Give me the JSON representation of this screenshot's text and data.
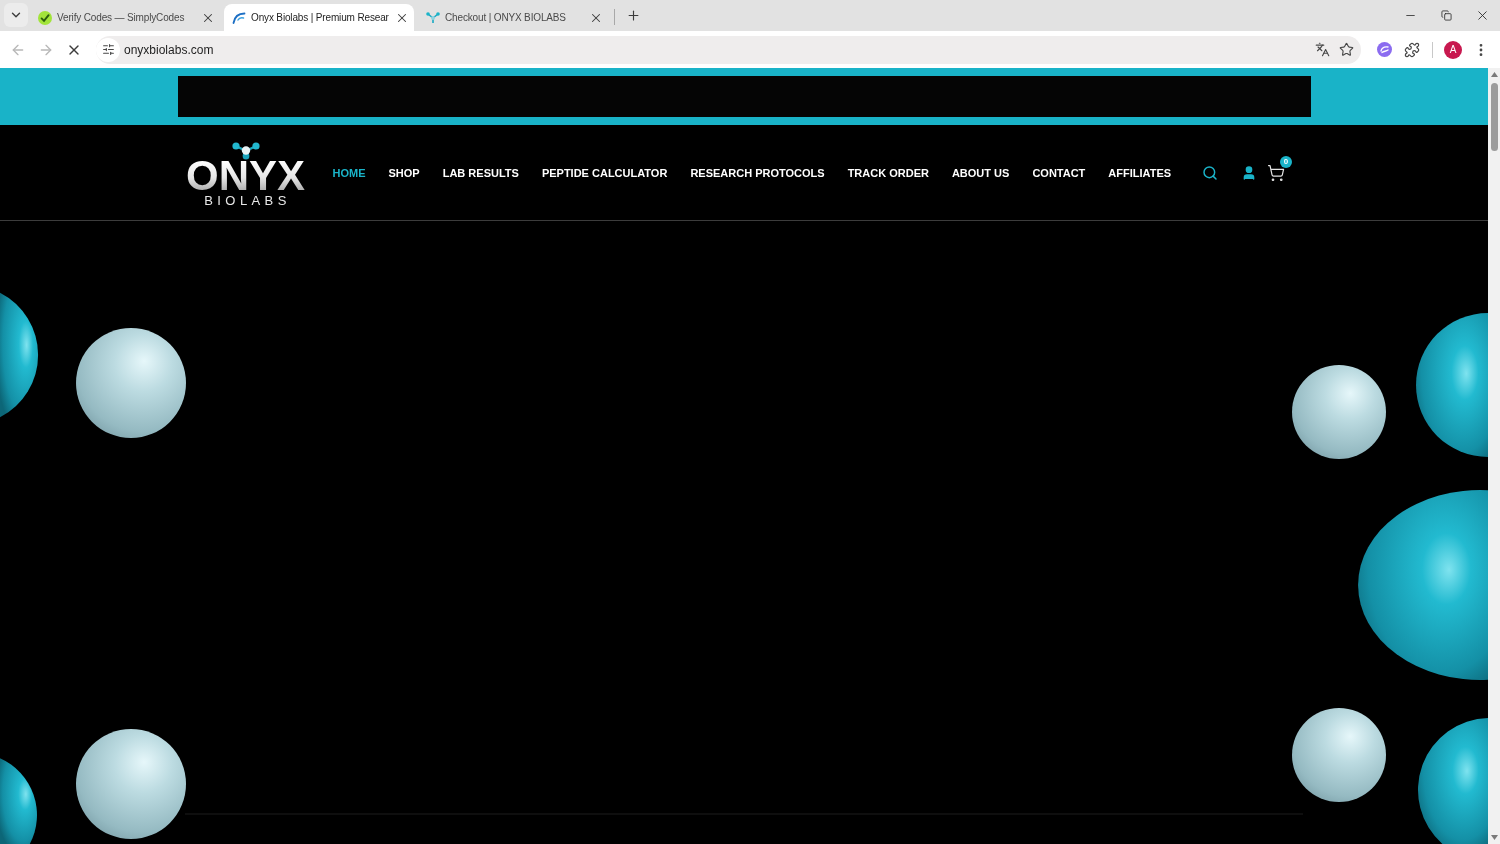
{
  "browser": {
    "tabs": [
      {
        "kind": "check",
        "title": "Verify Codes — SimplyCodes",
        "selected": false
      },
      {
        "kind": "swoosh",
        "title": "Onyx Biolabs | Premium Resear",
        "selected": true
      },
      {
        "kind": "molecule",
        "title": "Checkout | ONYX BIOLABS",
        "selected": false
      }
    ],
    "back": {
      "disabled": true
    },
    "forward": {
      "disabled": true
    },
    "loading": true,
    "address": "onyxbiolabs.com",
    "profile_initial": "A"
  },
  "page": {
    "logo": {
      "wordmark": "ONYX",
      "subtitle": "BIOLABS"
    },
    "nav": [
      {
        "label": "HOME",
        "selected": true
      },
      {
        "label": "SHOP",
        "selected": false
      },
      {
        "label": "LAB RESULTS",
        "selected": false
      },
      {
        "label": "PEPTIDE CALCULATOR",
        "selected": false
      },
      {
        "label": "RESEARCH PROTOCOLS",
        "selected": false
      },
      {
        "label": "TRACK ORDER",
        "selected": false
      },
      {
        "label": "ABOUT US",
        "selected": false
      },
      {
        "label": "CONTACT",
        "selected": false
      },
      {
        "label": "AFFILIATES",
        "selected": false
      }
    ],
    "cart_count": "0"
  }
}
